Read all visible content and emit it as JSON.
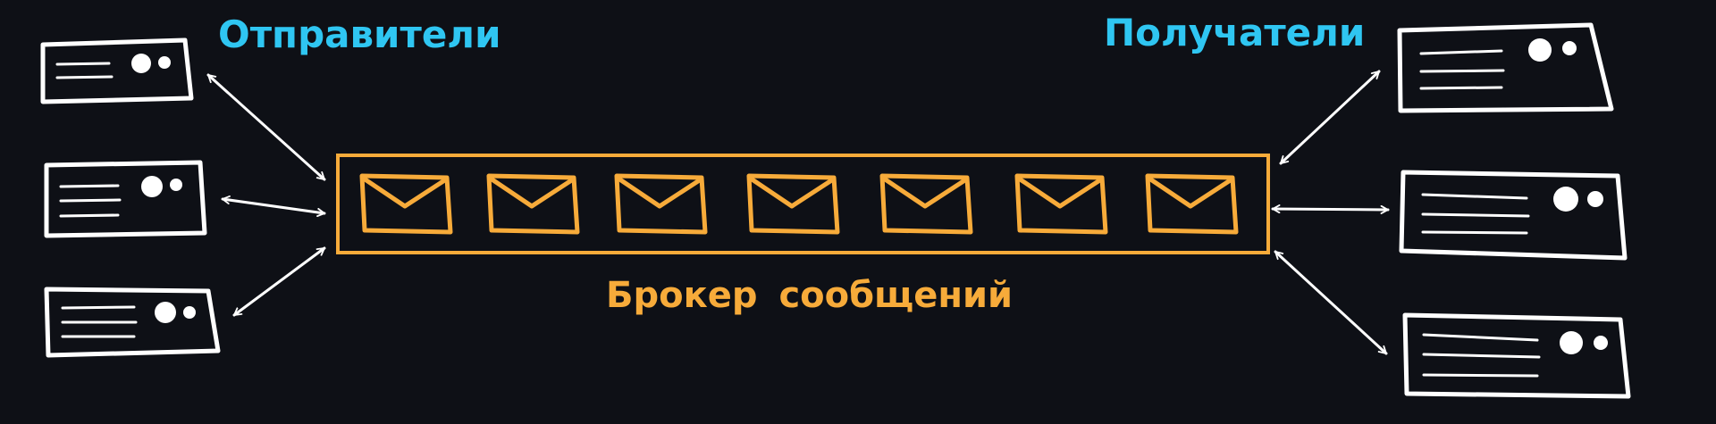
{
  "titles": {
    "senders": "Отправители",
    "receivers": "Получатели",
    "broker": "Брокер сообщений"
  },
  "colors": {
    "background": "#0e1016",
    "group_title": "#2fc6f2",
    "broker": "#f7ab3a",
    "outline": "#ffffff"
  },
  "icons": {
    "server": "server-icon",
    "message": "envelope-icon",
    "link": "double-arrow-icon"
  },
  "senders_count": 3,
  "receivers_count": 3,
  "queue_message_count": 7
}
